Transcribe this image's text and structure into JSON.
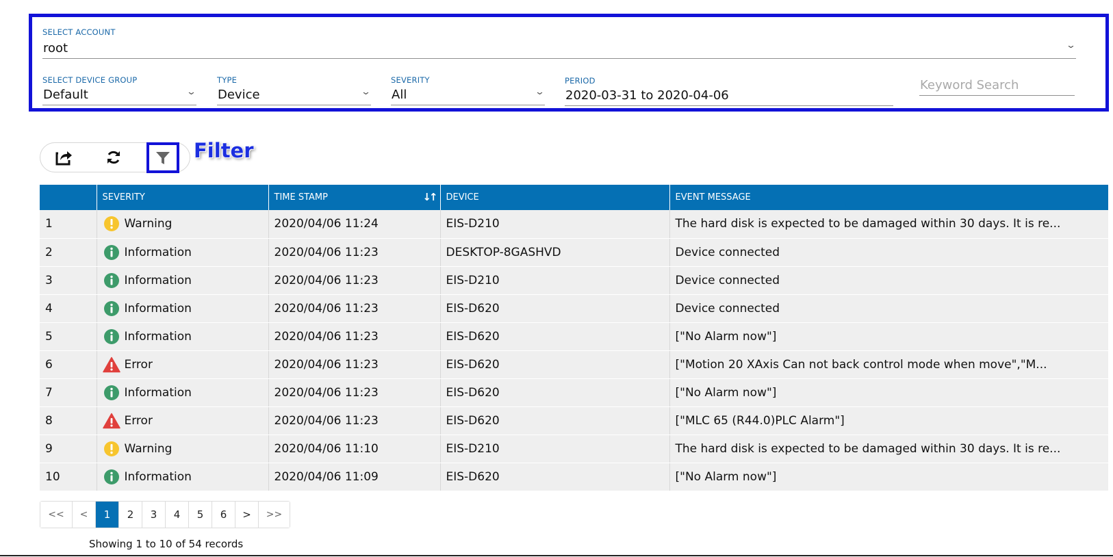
{
  "filters": {
    "account": {
      "label": "SELECT ACCOUNT",
      "value": "root"
    },
    "device_group": {
      "label": "SELECT DEVICE GROUP",
      "value": "Default"
    },
    "type": {
      "label": "TYPE",
      "value": "Device"
    },
    "severity": {
      "label": "SEVERITY",
      "value": "All"
    },
    "period": {
      "label": "PERIOD",
      "value": "2020-03-31 to 2020-04-06"
    },
    "keyword": {
      "placeholder": "Keyword Search"
    }
  },
  "toolbar": {
    "export_icon": "export-icon",
    "refresh_icon": "refresh-icon",
    "filter_icon": "filter-icon",
    "callout": "Filter"
  },
  "table": {
    "headers": [
      "",
      "SEVERITY",
      "TIME STAMP",
      "DEVICE",
      "EVENT MESSAGE"
    ],
    "rows": [
      {
        "num": "1",
        "severity": "Warning",
        "icon": "warning",
        "time": "2020/04/06 11:24",
        "device": "EIS-D210",
        "message": "The hard disk is expected to be damaged within 30 days. It is re..."
      },
      {
        "num": "2",
        "severity": "Information",
        "icon": "info",
        "time": "2020/04/06 11:23",
        "device": "DESKTOP-8GASHVD",
        "message": "Device connected"
      },
      {
        "num": "3",
        "severity": "Information",
        "icon": "info",
        "time": "2020/04/06 11:23",
        "device": "EIS-D210",
        "message": "Device connected"
      },
      {
        "num": "4",
        "severity": "Information",
        "icon": "info",
        "time": "2020/04/06 11:23",
        "device": "EIS-D620",
        "message": "Device connected"
      },
      {
        "num": "5",
        "severity": "Information",
        "icon": "info",
        "time": "2020/04/06 11:23",
        "device": "EIS-D620",
        "message": "[\"No Alarm now\"]"
      },
      {
        "num": "6",
        "severity": "Error",
        "icon": "error",
        "time": "2020/04/06 11:23",
        "device": "EIS-D620",
        "message": "[\"Motion 20 XAxis Can not back control mode when move\",\"M..."
      },
      {
        "num": "7",
        "severity": "Information",
        "icon": "info",
        "time": "2020/04/06 11:23",
        "device": "EIS-D620",
        "message": "[\"No Alarm now\"]"
      },
      {
        "num": "8",
        "severity": "Error",
        "icon": "error",
        "time": "2020/04/06 11:23",
        "device": "EIS-D620",
        "message": "[\"MLC 65 (R44.0)PLC Alarm\"]"
      },
      {
        "num": "9",
        "severity": "Warning",
        "icon": "warning",
        "time": "2020/04/06 11:10",
        "device": "EIS-D210",
        "message": "The hard disk is expected to be damaged within 30 days. It is re..."
      },
      {
        "num": "10",
        "severity": "Information",
        "icon": "info",
        "time": "2020/04/06 11:09",
        "device": "EIS-D620",
        "message": "[\"No Alarm now\"]"
      }
    ]
  },
  "pagination": {
    "first": "<<",
    "prev": "<",
    "pages": [
      "1",
      "2",
      "3",
      "4",
      "5",
      "6"
    ],
    "active_page": "1",
    "next": ">",
    "last": ">>",
    "summary": "Showing 1 to 10 of 54 records"
  },
  "colors": {
    "header_blue": "#0570b4",
    "highlight_blue": "#1212d8",
    "warning": "#f7c52e",
    "info": "#3d9b6a",
    "error": "#e0403c"
  }
}
